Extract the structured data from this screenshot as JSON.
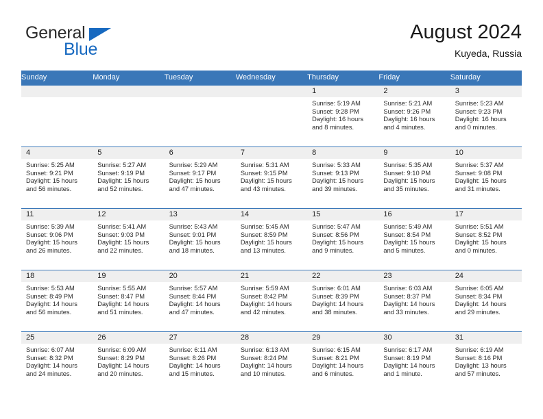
{
  "brand": {
    "word_general": "General",
    "word_blue": "Blue",
    "accent_color": "#1769c0"
  },
  "header": {
    "title": "August 2024",
    "subtitle": "Kuyeda, Russia",
    "header_bg": "#3a77b8",
    "daynum_bg": "#efefef"
  },
  "calendar": {
    "weekday_headers": [
      "Sunday",
      "Monday",
      "Tuesday",
      "Wednesday",
      "Thursday",
      "Friday",
      "Saturday"
    ],
    "labels": {
      "sunrise": "Sunrise:",
      "sunset": "Sunset:",
      "daylight": "Daylight:"
    },
    "weeks": [
      [
        {
          "day": "",
          "sunrise": "",
          "sunset": "",
          "daylight": ""
        },
        {
          "day": "",
          "sunrise": "",
          "sunset": "",
          "daylight": ""
        },
        {
          "day": "",
          "sunrise": "",
          "sunset": "",
          "daylight": ""
        },
        {
          "day": "",
          "sunrise": "",
          "sunset": "",
          "daylight": ""
        },
        {
          "day": "1",
          "sunrise": "Sunrise: 5:19 AM",
          "sunset": "Sunset: 9:28 PM",
          "daylight_line1": "Daylight: 16 hours",
          "daylight_line2": "and 8 minutes."
        },
        {
          "day": "2",
          "sunrise": "Sunrise: 5:21 AM",
          "sunset": "Sunset: 9:26 PM",
          "daylight_line1": "Daylight: 16 hours",
          "daylight_line2": "and 4 minutes."
        },
        {
          "day": "3",
          "sunrise": "Sunrise: 5:23 AM",
          "sunset": "Sunset: 9:23 PM",
          "daylight_line1": "Daylight: 16 hours",
          "daylight_line2": "and 0 minutes."
        }
      ],
      [
        {
          "day": "4",
          "sunrise": "Sunrise: 5:25 AM",
          "sunset": "Sunset: 9:21 PM",
          "daylight_line1": "Daylight: 15 hours",
          "daylight_line2": "and 56 minutes."
        },
        {
          "day": "5",
          "sunrise": "Sunrise: 5:27 AM",
          "sunset": "Sunset: 9:19 PM",
          "daylight_line1": "Daylight: 15 hours",
          "daylight_line2": "and 52 minutes."
        },
        {
          "day": "6",
          "sunrise": "Sunrise: 5:29 AM",
          "sunset": "Sunset: 9:17 PM",
          "daylight_line1": "Daylight: 15 hours",
          "daylight_line2": "and 47 minutes."
        },
        {
          "day": "7",
          "sunrise": "Sunrise: 5:31 AM",
          "sunset": "Sunset: 9:15 PM",
          "daylight_line1": "Daylight: 15 hours",
          "daylight_line2": "and 43 minutes."
        },
        {
          "day": "8",
          "sunrise": "Sunrise: 5:33 AM",
          "sunset": "Sunset: 9:13 PM",
          "daylight_line1": "Daylight: 15 hours",
          "daylight_line2": "and 39 minutes."
        },
        {
          "day": "9",
          "sunrise": "Sunrise: 5:35 AM",
          "sunset": "Sunset: 9:10 PM",
          "daylight_line1": "Daylight: 15 hours",
          "daylight_line2": "and 35 minutes."
        },
        {
          "day": "10",
          "sunrise": "Sunrise: 5:37 AM",
          "sunset": "Sunset: 9:08 PM",
          "daylight_line1": "Daylight: 15 hours",
          "daylight_line2": "and 31 minutes."
        }
      ],
      [
        {
          "day": "11",
          "sunrise": "Sunrise: 5:39 AM",
          "sunset": "Sunset: 9:06 PM",
          "daylight_line1": "Daylight: 15 hours",
          "daylight_line2": "and 26 minutes."
        },
        {
          "day": "12",
          "sunrise": "Sunrise: 5:41 AM",
          "sunset": "Sunset: 9:03 PM",
          "daylight_line1": "Daylight: 15 hours",
          "daylight_line2": "and 22 minutes."
        },
        {
          "day": "13",
          "sunrise": "Sunrise: 5:43 AM",
          "sunset": "Sunset: 9:01 PM",
          "daylight_line1": "Daylight: 15 hours",
          "daylight_line2": "and 18 minutes."
        },
        {
          "day": "14",
          "sunrise": "Sunrise: 5:45 AM",
          "sunset": "Sunset: 8:59 PM",
          "daylight_line1": "Daylight: 15 hours",
          "daylight_line2": "and 13 minutes."
        },
        {
          "day": "15",
          "sunrise": "Sunrise: 5:47 AM",
          "sunset": "Sunset: 8:56 PM",
          "daylight_line1": "Daylight: 15 hours",
          "daylight_line2": "and 9 minutes."
        },
        {
          "day": "16",
          "sunrise": "Sunrise: 5:49 AM",
          "sunset": "Sunset: 8:54 PM",
          "daylight_line1": "Daylight: 15 hours",
          "daylight_line2": "and 5 minutes."
        },
        {
          "day": "17",
          "sunrise": "Sunrise: 5:51 AM",
          "sunset": "Sunset: 8:52 PM",
          "daylight_line1": "Daylight: 15 hours",
          "daylight_line2": "and 0 minutes."
        }
      ],
      [
        {
          "day": "18",
          "sunrise": "Sunrise: 5:53 AM",
          "sunset": "Sunset: 8:49 PM",
          "daylight_line1": "Daylight: 14 hours",
          "daylight_line2": "and 56 minutes."
        },
        {
          "day": "19",
          "sunrise": "Sunrise: 5:55 AM",
          "sunset": "Sunset: 8:47 PM",
          "daylight_line1": "Daylight: 14 hours",
          "daylight_line2": "and 51 minutes."
        },
        {
          "day": "20",
          "sunrise": "Sunrise: 5:57 AM",
          "sunset": "Sunset: 8:44 PM",
          "daylight_line1": "Daylight: 14 hours",
          "daylight_line2": "and 47 minutes."
        },
        {
          "day": "21",
          "sunrise": "Sunrise: 5:59 AM",
          "sunset": "Sunset: 8:42 PM",
          "daylight_line1": "Daylight: 14 hours",
          "daylight_line2": "and 42 minutes."
        },
        {
          "day": "22",
          "sunrise": "Sunrise: 6:01 AM",
          "sunset": "Sunset: 8:39 PM",
          "daylight_line1": "Daylight: 14 hours",
          "daylight_line2": "and 38 minutes."
        },
        {
          "day": "23",
          "sunrise": "Sunrise: 6:03 AM",
          "sunset": "Sunset: 8:37 PM",
          "daylight_line1": "Daylight: 14 hours",
          "daylight_line2": "and 33 minutes."
        },
        {
          "day": "24",
          "sunrise": "Sunrise: 6:05 AM",
          "sunset": "Sunset: 8:34 PM",
          "daylight_line1": "Daylight: 14 hours",
          "daylight_line2": "and 29 minutes."
        }
      ],
      [
        {
          "day": "25",
          "sunrise": "Sunrise: 6:07 AM",
          "sunset": "Sunset: 8:32 PM",
          "daylight_line1": "Daylight: 14 hours",
          "daylight_line2": "and 24 minutes."
        },
        {
          "day": "26",
          "sunrise": "Sunrise: 6:09 AM",
          "sunset": "Sunset: 8:29 PM",
          "daylight_line1": "Daylight: 14 hours",
          "daylight_line2": "and 20 minutes."
        },
        {
          "day": "27",
          "sunrise": "Sunrise: 6:11 AM",
          "sunset": "Sunset: 8:26 PM",
          "daylight_line1": "Daylight: 14 hours",
          "daylight_line2": "and 15 minutes."
        },
        {
          "day": "28",
          "sunrise": "Sunrise: 6:13 AM",
          "sunset": "Sunset: 8:24 PM",
          "daylight_line1": "Daylight: 14 hours",
          "daylight_line2": "and 10 minutes."
        },
        {
          "day": "29",
          "sunrise": "Sunrise: 6:15 AM",
          "sunset": "Sunset: 8:21 PM",
          "daylight_line1": "Daylight: 14 hours",
          "daylight_line2": "and 6 minutes."
        },
        {
          "day": "30",
          "sunrise": "Sunrise: 6:17 AM",
          "sunset": "Sunset: 8:19 PM",
          "daylight_line1": "Daylight: 14 hours",
          "daylight_line2": "and 1 minute."
        },
        {
          "day": "31",
          "sunrise": "Sunrise: 6:19 AM",
          "sunset": "Sunset: 8:16 PM",
          "daylight_line1": "Daylight: 13 hours",
          "daylight_line2": "and 57 minutes."
        }
      ]
    ]
  }
}
